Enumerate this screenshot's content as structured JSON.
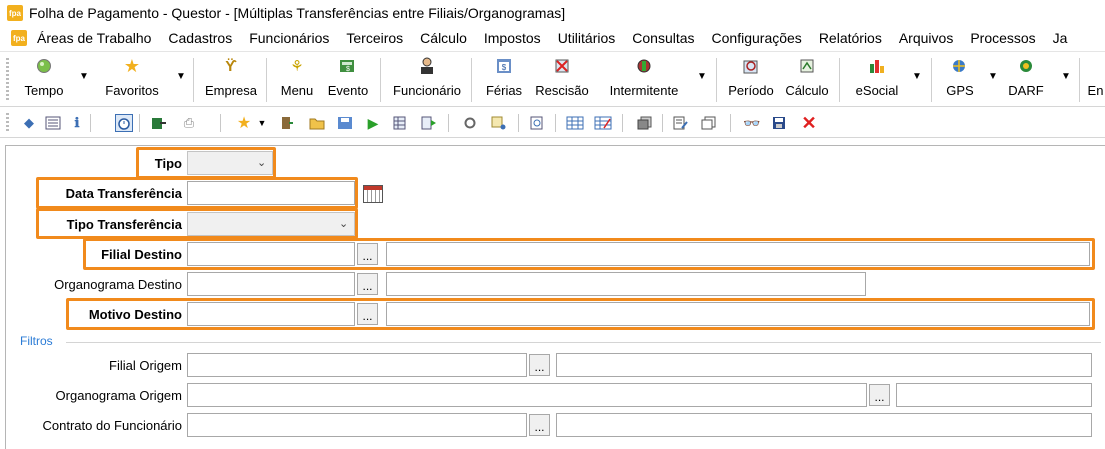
{
  "window": {
    "app_icon": "fpa",
    "title": "Folha de Pagamento - Questor - [Múltiplas Transferências entre Filiais/Organogramas]"
  },
  "menu": {
    "items": [
      "Áreas de Trabalho",
      "Cadastros",
      "Funcionários",
      "Terceiros",
      "Cálculo",
      "Impostos",
      "Utilitários",
      "Consultas",
      "Configurações",
      "Relatórios",
      "Arquivos",
      "Processos",
      "Ja"
    ]
  },
  "toolbar": {
    "buttons": [
      {
        "label": "Tempo",
        "icon": "green-circle-icon"
      },
      {
        "label": "Favoritos",
        "icon": "star-icon"
      },
      {
        "label": "Empresa",
        "icon": "company-icon"
      },
      {
        "label": "Menu",
        "icon": "menu-icon"
      },
      {
        "label": "Evento",
        "icon": "event-icon"
      },
      {
        "label": "Funcionário",
        "icon": "employee-icon"
      },
      {
        "label": "Férias",
        "icon": "vacation-icon"
      },
      {
        "label": "Rescisão",
        "icon": "termination-icon"
      },
      {
        "label": "Intermitente",
        "icon": "intermittent-icon"
      },
      {
        "label": "Período",
        "icon": "period-icon"
      },
      {
        "label": "Cálculo",
        "icon": "calculation-icon"
      },
      {
        "label": "eSocial",
        "icon": "esocial-icon"
      },
      {
        "label": "GPS",
        "icon": "gps-icon"
      },
      {
        "label": "DARF",
        "icon": "darf-icon"
      },
      {
        "label": "En",
        "icon": "blank-icon"
      }
    ]
  },
  "form": {
    "tipo": {
      "label": "Tipo",
      "value": ""
    },
    "data_transferencia": {
      "label": "Data Transferência",
      "value": ""
    },
    "tipo_transferencia": {
      "label": "Tipo Transferência",
      "value": ""
    },
    "filial_destino": {
      "label": "Filial Destino",
      "code": "",
      "name": "",
      "button": "..."
    },
    "organograma_destino": {
      "label": "Organograma Destino",
      "code": "",
      "name": "",
      "button": "..."
    },
    "motivo_destino": {
      "label": "Motivo Destino",
      "code": "",
      "name": "",
      "button": "..."
    }
  },
  "filters": {
    "title": "Filtros",
    "filial_origem": {
      "label": "Filial Origem",
      "code": "",
      "name": "",
      "button": "..."
    },
    "organograma_origem": {
      "label": "Organograma Origem",
      "code": "",
      "name": "",
      "button": "..."
    },
    "contrato_funcionario": {
      "label": "Contrato do Funcionário",
      "code": "",
      "name": "",
      "button": "..."
    }
  },
  "colors": {
    "highlight": "#f18a1c",
    "section_title": "#2a7bd6",
    "app_icon": "#f2b01e"
  }
}
